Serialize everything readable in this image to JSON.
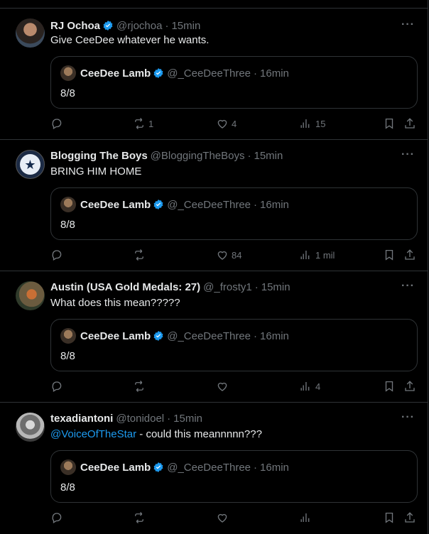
{
  "colors": {
    "accent": "#1d9bf0",
    "muted": "#71767b",
    "text": "#e7e9ea",
    "border": "#2f3336",
    "background": "#000000"
  },
  "quoted": {
    "name": "CeeDee Lamb",
    "handle": "@_CeeDeeThree",
    "time": "16min",
    "text": "8/8",
    "verified": true
  },
  "tweets": [
    {
      "name": "RJ Ochoa",
      "verified": true,
      "handle": "@rjochoa",
      "time": "15min",
      "text": "Give CeeDee whatever he wants.",
      "replies": "",
      "retweets": "1",
      "likes": "4",
      "views": "15",
      "avatar_icon": "person-photo"
    },
    {
      "name": "Blogging The Boys",
      "verified": false,
      "handle": "@BloggingTheBoys",
      "time": "15min",
      "text": "BRING HIM HOME",
      "replies": "",
      "retweets": "",
      "likes": "84",
      "views": "1 mil",
      "avatar_icon": "star-logo"
    },
    {
      "name": "Austin (USA Gold Medals: 27)",
      "verified": false,
      "handle": "@_frosty1",
      "time": "15min",
      "text": "What does this mean?????",
      "replies": "",
      "retweets": "",
      "likes": "",
      "views": "4",
      "avatar_icon": "person-photo"
    },
    {
      "name": "texadiantoni",
      "verified": false,
      "handle": "@tonidoel",
      "time": "15min",
      "mention": "@VoiceOfTheStar",
      "text_rest": " - could this meannnnn???",
      "replies": "",
      "retweets": "",
      "likes": "",
      "views": "",
      "avatar_icon": "person-photo"
    }
  ],
  "separator": "·",
  "more_label": "···"
}
